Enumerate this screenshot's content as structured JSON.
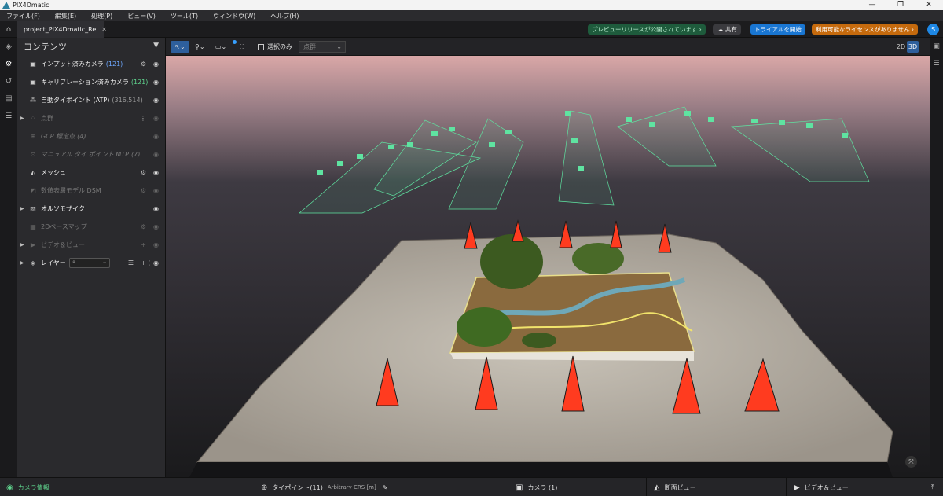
{
  "window": {
    "title": "PIX4Dmatic",
    "controls": [
      "—",
      "❐",
      "✕"
    ]
  },
  "menu": [
    "ファイル(F)",
    "編集(E)",
    "処理(P)",
    "ビュー(V)",
    "ツール(T)",
    "ウィンドウ(W)",
    "ヘルプ(H)"
  ],
  "tab": {
    "label": "project_PIX4Dmatic_Re",
    "close": "✕"
  },
  "header": {
    "preview": "プレビューリリースが公開されています ›",
    "share": "共有",
    "trial": "トライアルを開始",
    "license": "利用可能なライセンスがありません ›",
    "avatar": "S"
  },
  "panel": {
    "title": "コンテンツ",
    "rows": [
      {
        "name": "インプット済みカメラ",
        "count": "(121)",
        "count_color": "#6ea8ff",
        "icon": "camera-icon"
      },
      {
        "name": "キャリブレーション済みカメラ",
        "count": "(121)",
        "count_color": "#5fd38d",
        "icon": "calibrated-camera-icon"
      },
      {
        "name": "自動タイポイント (ATP)",
        "count": "(316,514)",
        "count_color": "#9a9a9a",
        "icon": "atp-icon"
      },
      {
        "name": "点群",
        "count": "",
        "icon": "point-cloud-icon"
      },
      {
        "name": "GCP 標定点",
        "count": "(4)",
        "icon": "gcp-icon"
      },
      {
        "name": "マニュアル タイ ポイント MTP",
        "count": "(7)",
        "icon": "mtp-icon"
      },
      {
        "name": "メッシュ",
        "count": "",
        "icon": "mesh-icon"
      },
      {
        "name": "数値表層モデル DSM",
        "count": "",
        "icon": "dsm-icon"
      },
      {
        "name": "オルソモザイク",
        "count": "",
        "icon": "ortho-icon"
      },
      {
        "name": "2Dベースマップ",
        "count": "",
        "icon": "basemap-icon"
      },
      {
        "name": "ビデオ＆ビュー",
        "count": "",
        "icon": "video-icon"
      },
      {
        "name": "レイヤー",
        "count": "",
        "icon": "layers-icon"
      }
    ]
  },
  "toolbar": {
    "selection_only": "選択のみ",
    "layer_dropdown": "点群",
    "mode_2d": "2D",
    "mode_3d": "3D"
  },
  "status": {
    "camera_info": "カメラ情報",
    "tiepoints": "タイポイント(11)",
    "crs": "Arbitrary CRS [m]",
    "camera": "カメラ (1)",
    "section": "断面ビュー",
    "video": "ビデオ＆ビュー"
  },
  "colors": {
    "accent": "#1976d2",
    "camera_frustum": "#5fe3a1",
    "cone": "#ff3b1f",
    "license": "#c56a0d"
  }
}
